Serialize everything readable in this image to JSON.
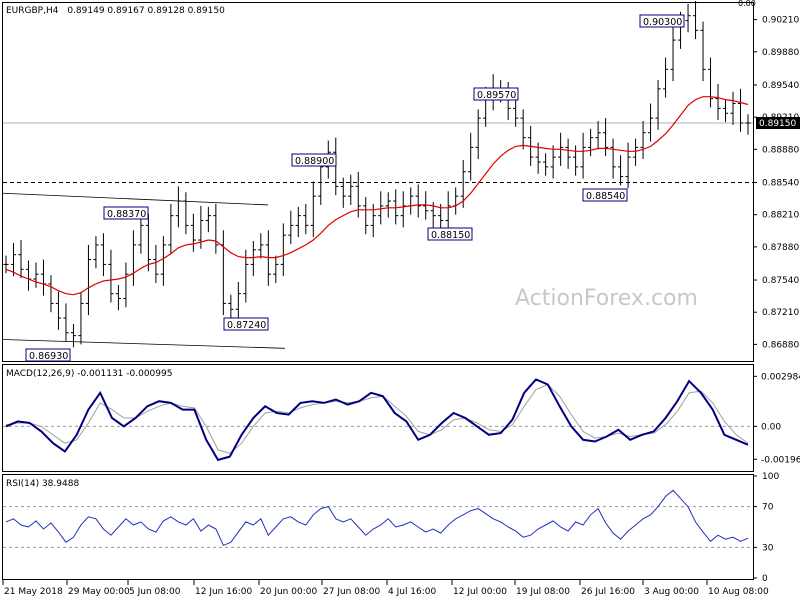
{
  "header": {
    "symbol": "EURGBP,H4",
    "ohlc": "0.89149 0.89167 0.89128 0.89150",
    "top_right_corner": "0.00"
  },
  "watermark": "ActionForex.com",
  "colors": {
    "price": "#000000",
    "ma": "#e00000",
    "macd_main": "#000080",
    "macd_signal": "#a0a0a0",
    "rsi": "#2030c0",
    "background": "#ffffff",
    "grid_dashed": "#999999"
  },
  "chart_data": [
    {
      "type": "line",
      "panel": "price",
      "title": "EURGBP,H4",
      "y_ticks": [
        "0.90210",
        "0.89880",
        "0.89540",
        "0.89210",
        "0.88880",
        "0.88540",
        "0.88210",
        "0.87880",
        "0.87540",
        "0.87210",
        "0.86880"
      ],
      "y_tick_values": [
        0.9021,
        0.8988,
        0.8954,
        0.8921,
        0.8888,
        0.8854,
        0.8821,
        0.8788,
        0.8754,
        0.8721,
        0.8688
      ],
      "ylim": [
        0.8672,
        0.9037
      ],
      "x_ticks": [
        "21 May 2018",
        "29 May 00:00",
        "5 Jun 08:00",
        "12 Jun 16:00",
        "20 Jun 00:00",
        "27 Jun 08:00",
        "4 Jul 16:00",
        "12 Jul 00:00",
        "19 Jul 08:00",
        "26 Jul 16:00",
        "3 Aug 00:00",
        "10 Aug 08:00"
      ],
      "current_price": "0.89150",
      "current_price_value": 0.8915,
      "support_level": "0.88540",
      "support_level_value": 0.8854,
      "price_series": [
        0.877,
        0.878,
        0.8765,
        0.8755,
        0.876,
        0.875,
        0.873,
        0.8715,
        0.87,
        0.8697,
        0.873,
        0.8775,
        0.879,
        0.877,
        0.874,
        0.8735,
        0.876,
        0.879,
        0.881,
        0.8775,
        0.876,
        0.879,
        0.882,
        0.8835,
        0.881,
        0.8795,
        0.8815,
        0.882,
        0.879,
        0.873,
        0.8724,
        0.874,
        0.877,
        0.8785,
        0.879,
        0.876,
        0.877,
        0.88,
        0.881,
        0.882,
        0.881,
        0.884,
        0.887,
        0.8885,
        0.885,
        0.884,
        0.885,
        0.883,
        0.881,
        0.882,
        0.883,
        0.8835,
        0.882,
        0.883,
        0.884,
        0.883,
        0.8825,
        0.882,
        0.8815,
        0.883,
        0.884,
        0.8865,
        0.889,
        0.892,
        0.894,
        0.895,
        0.8945,
        0.893,
        0.892,
        0.89,
        0.888,
        0.8875,
        0.887,
        0.888,
        0.889,
        0.888,
        0.887,
        0.889,
        0.89,
        0.8905,
        0.889,
        0.887,
        0.886,
        0.888,
        0.889,
        0.8905,
        0.892,
        0.895,
        0.897,
        0.9,
        0.902,
        0.9025,
        0.901,
        0.897,
        0.894,
        0.893,
        0.8925,
        0.8935,
        0.8915,
        0.8915
      ],
      "ma_series": [
        0.8765,
        0.8762,
        0.8758,
        0.8755,
        0.8752,
        0.875,
        0.8747,
        0.8743,
        0.874,
        0.8739,
        0.8741,
        0.8746,
        0.875,
        0.8753,
        0.8754,
        0.8755,
        0.8757,
        0.8761,
        0.8766,
        0.877,
        0.8772,
        0.8776,
        0.8781,
        0.8787,
        0.879,
        0.8791,
        0.8793,
        0.8795,
        0.8794,
        0.8788,
        0.8782,
        0.8778,
        0.8777,
        0.8777,
        0.8778,
        0.8777,
        0.8777,
        0.8779,
        0.8782,
        0.8786,
        0.879,
        0.8795,
        0.8802,
        0.881,
        0.8816,
        0.882,
        0.8824,
        0.8826,
        0.8826,
        0.8826,
        0.8827,
        0.8828,
        0.8828,
        0.8829,
        0.883,
        0.8831,
        0.8831,
        0.883,
        0.8828,
        0.8828,
        0.883,
        0.8835,
        0.8843,
        0.8853,
        0.8863,
        0.8873,
        0.8881,
        0.8887,
        0.8891,
        0.8892,
        0.8891,
        0.889,
        0.8889,
        0.8888,
        0.8888,
        0.8887,
        0.8886,
        0.8886,
        0.8887,
        0.8889,
        0.8889,
        0.8888,
        0.8887,
        0.8886,
        0.8886,
        0.8888,
        0.8891,
        0.8897,
        0.8904,
        0.8913,
        0.8923,
        0.8933,
        0.8939,
        0.8942,
        0.8942,
        0.8941,
        0.8939,
        0.8938,
        0.8936,
        0.8934
      ],
      "annotations": [
        {
          "label": "0.88370",
          "value": 0.8837
        },
        {
          "label": "0.86930",
          "value": 0.8693
        },
        {
          "label": "0.88900",
          "value": 0.889
        },
        {
          "label": "0.87240",
          "value": 0.8724
        },
        {
          "label": "0.88150",
          "value": 0.8815
        },
        {
          "label": "0.89570",
          "value": 0.8957
        },
        {
          "label": "0.88540",
          "value": 0.8854
        },
        {
          "label": "0.90300",
          "value": 0.903
        }
      ]
    },
    {
      "type": "line",
      "panel": "macd",
      "title": "MACD(12,26,9) -0.001131 -0.000995",
      "y_ticks": [
        "0.002984",
        "0.00",
        "-0.00196"
      ],
      "y_tick_values": [
        0.002984,
        0.0,
        -0.00196
      ],
      "ylim": [
        -0.0026,
        0.0036
      ],
      "series": [
        {
          "role": "main",
          "values": [
            0.0,
            0.0003,
            0.0002,
            -0.0003,
            -0.001,
            -0.0015,
            -0.0005,
            0.001,
            0.002,
            0.0005,
            0.0,
            0.0005,
            0.0012,
            0.0015,
            0.0014,
            0.001,
            0.001,
            -0.0008,
            -0.002,
            -0.0018,
            -0.0005,
            0.0005,
            0.0012,
            0.0008,
            0.0007,
            0.0014,
            0.0015,
            0.0014,
            0.0016,
            0.0013,
            0.0015,
            0.002,
            0.0018,
            0.0008,
            0.0003,
            -0.0008,
            -0.0005,
            0.0002,
            0.0008,
            0.0005,
            0.0,
            -0.0005,
            -0.0004,
            0.0004,
            0.002,
            0.0028,
            0.0025,
            0.0012,
            0.0,
            -0.0008,
            -0.0009,
            -0.0006,
            -0.0002,
            -0.0008,
            -0.0005,
            -0.0003,
            0.0005,
            0.0015,
            0.0027,
            0.002,
            0.001,
            -0.0005,
            -0.0008,
            -0.0011
          ]
        },
        {
          "role": "signal",
          "values": [
            0.0001,
            0.0002,
            0.0002,
            0.0,
            -0.0005,
            -0.001,
            -0.0008,
            0.0002,
            0.0014,
            0.001,
            0.0005,
            0.0005,
            0.0009,
            0.0012,
            0.0014,
            0.0012,
            0.0011,
            0.0,
            -0.0014,
            -0.0016,
            -0.001,
            0.0,
            0.0008,
            0.0009,
            0.0008,
            0.0011,
            0.0013,
            0.0014,
            0.0015,
            0.0014,
            0.0015,
            0.0017,
            0.0018,
            0.0012,
            0.0006,
            -0.0003,
            -0.0005,
            -0.0002,
            0.0004,
            0.0005,
            0.0002,
            -0.0002,
            -0.0003,
            0.0001,
            0.0012,
            0.0022,
            0.0025,
            0.0018,
            0.0007,
            -0.0003,
            -0.0007,
            -0.0006,
            -0.0004,
            -0.0006,
            -0.0005,
            -0.0004,
            0.0001,
            0.0009,
            0.002,
            0.0021,
            0.0014,
            0.0003,
            -0.0005,
            -0.001
          ]
        }
      ]
    },
    {
      "type": "line",
      "panel": "rsi",
      "title": "RSI(14) 38.9488",
      "y_ticks": [
        "100",
        "70",
        "30",
        "0"
      ],
      "y_tick_values": [
        100,
        70,
        30,
        0
      ],
      "levels": [
        70,
        30
      ],
      "ylim": [
        0,
        100
      ],
      "values": [
        55,
        58,
        52,
        50,
        56,
        48,
        54,
        45,
        35,
        40,
        52,
        60,
        58,
        48,
        42,
        50,
        58,
        52,
        55,
        48,
        45,
        56,
        60,
        55,
        52,
        58,
        46,
        52,
        48,
        32,
        35,
        45,
        55,
        52,
        58,
        42,
        50,
        58,
        60,
        55,
        52,
        62,
        68,
        70,
        58,
        55,
        58,
        50,
        42,
        48,
        52,
        58,
        50,
        52,
        55,
        50,
        45,
        48,
        44,
        52,
        58,
        62,
        66,
        68,
        63,
        58,
        55,
        50,
        46,
        40,
        42,
        48,
        52,
        56,
        50,
        46,
        55,
        52,
        62,
        68,
        54,
        44,
        38,
        46,
        52,
        58,
        62,
        70,
        80,
        86,
        78,
        70,
        55,
        45,
        36,
        42,
        38,
        40,
        36,
        39
      ]
    }
  ]
}
